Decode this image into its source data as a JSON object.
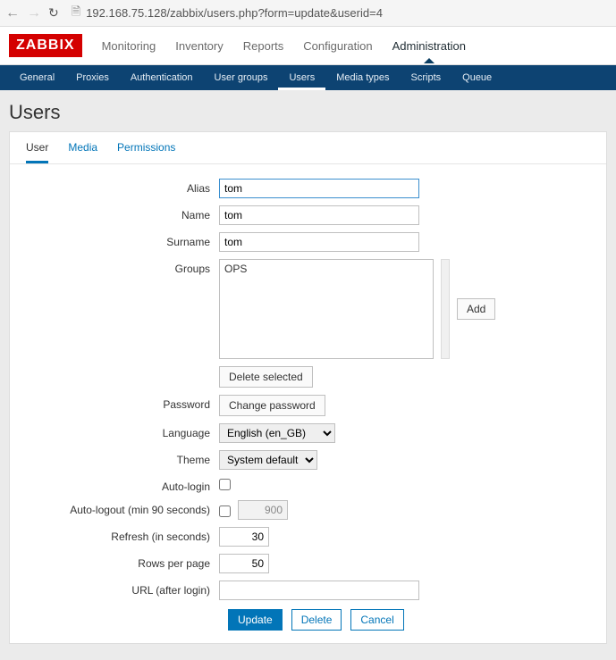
{
  "browser": {
    "url": "192.168.75.128/zabbix/users.php?form=update&userid=4"
  },
  "logo": "ZABBIX",
  "topnav": {
    "monitoring": "Monitoring",
    "inventory": "Inventory",
    "reports": "Reports",
    "configuration": "Configuration",
    "administration": "Administration"
  },
  "subnav": {
    "general": "General",
    "proxies": "Proxies",
    "authentication": "Authentication",
    "user_groups": "User groups",
    "users": "Users",
    "media_types": "Media types",
    "scripts": "Scripts",
    "queue": "Queue"
  },
  "page_title": "Users",
  "tabs": {
    "user": "User",
    "media": "Media",
    "permissions": "Permissions"
  },
  "form": {
    "alias": {
      "label": "Alias",
      "value": "tom"
    },
    "name": {
      "label": "Name",
      "value": "tom"
    },
    "surname": {
      "label": "Surname",
      "value": "tom"
    },
    "groups": {
      "label": "Groups",
      "value": "OPS",
      "add": "Add",
      "delete_selected": "Delete selected"
    },
    "password": {
      "label": "Password",
      "button": "Change password"
    },
    "language": {
      "label": "Language",
      "value": "English (en_GB)"
    },
    "theme": {
      "label": "Theme",
      "value": "System default"
    },
    "auto_login": {
      "label": "Auto-login"
    },
    "auto_logout": {
      "label": "Auto-logout (min 90 seconds)",
      "value": "900"
    },
    "refresh": {
      "label": "Refresh (in seconds)",
      "value": "30"
    },
    "rows": {
      "label": "Rows per page",
      "value": "50"
    },
    "url": {
      "label": "URL (after login)",
      "value": ""
    }
  },
  "actions": {
    "update": "Update",
    "delete": "Delete",
    "cancel": "Cancel"
  }
}
